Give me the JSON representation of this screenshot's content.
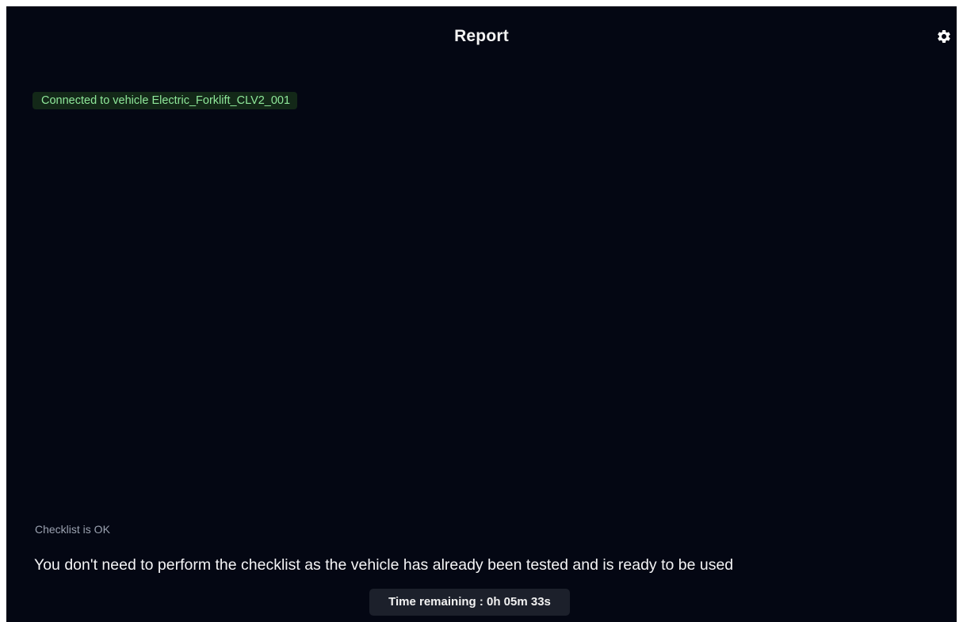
{
  "header": {
    "title": "Report",
    "settings_icon": "gear-icon"
  },
  "connection": {
    "text": "Connected to vehicle Electric_Forklift_CLV2_001",
    "color": "#8fe89a"
  },
  "checklist": {
    "status": "Checklist is OK",
    "message": "You don't need to perform the checklist as the vehicle has already been tested and is ready to be used"
  },
  "timer": {
    "text": "Time remaining : 0h 05m 33s"
  },
  "colors": {
    "background": "#040713",
    "connected_badge_bg": "#132818",
    "timer_bg": "#1c202b"
  }
}
